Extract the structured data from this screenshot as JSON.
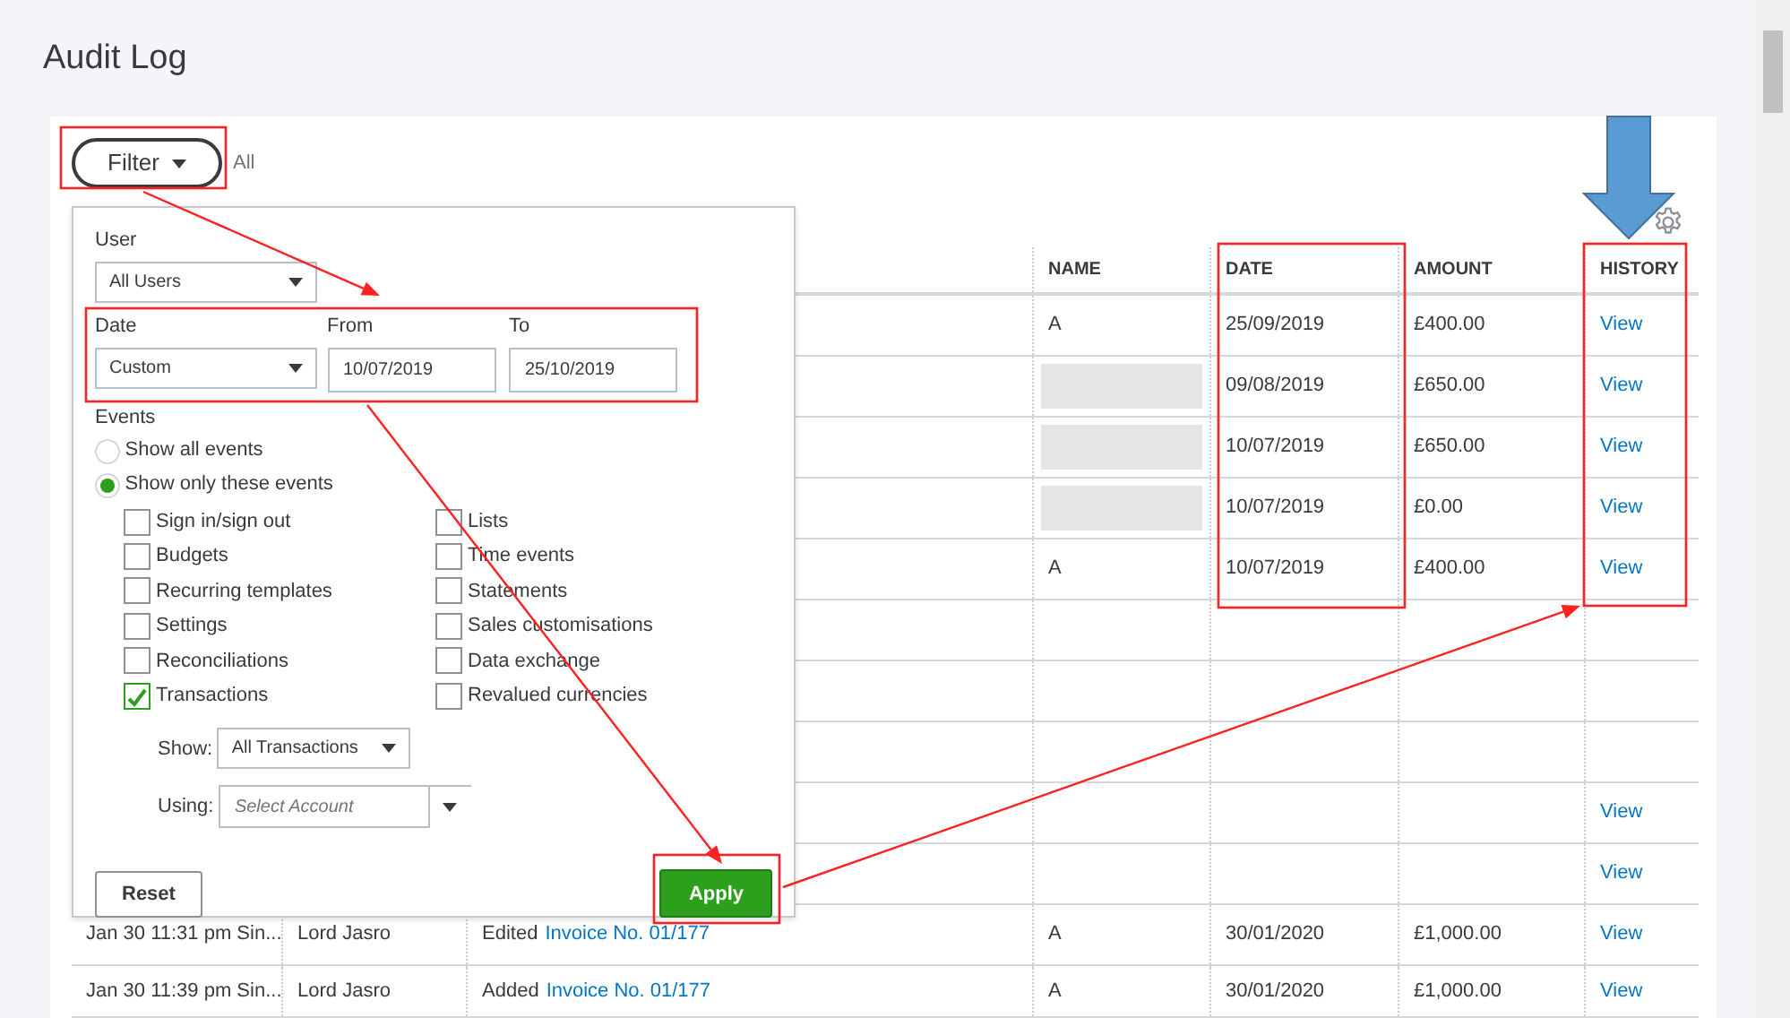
{
  "page": {
    "title": "Audit Log"
  },
  "filter": {
    "button": "Filter",
    "summary": "All",
    "open": true
  },
  "filter_panel": {
    "user": {
      "label": "User",
      "value": "All Users"
    },
    "date": {
      "label": "Date",
      "value": "Custom"
    },
    "from": {
      "label": "From",
      "value": "10/07/2019"
    },
    "to": {
      "label": "To",
      "value": "25/10/2019"
    },
    "events_label": "Events",
    "event_modes": [
      {
        "label": "Show all events",
        "selected": false
      },
      {
        "label": "Show only these events",
        "selected": true
      }
    ],
    "event_types": [
      {
        "label": "Sign in/sign out",
        "checked": false
      },
      {
        "label": "Lists",
        "checked": false
      },
      {
        "label": "Budgets",
        "checked": false
      },
      {
        "label": "Time events",
        "checked": false
      },
      {
        "label": "Recurring templates",
        "checked": false
      },
      {
        "label": "Statements",
        "checked": false
      },
      {
        "label": "Settings",
        "checked": false
      },
      {
        "label": "Sales customisations",
        "checked": false
      },
      {
        "label": "Reconciliations",
        "checked": false
      },
      {
        "label": "Data exchange",
        "checked": false
      },
      {
        "label": "Transactions",
        "checked": true
      },
      {
        "label": "Revalued currencies",
        "checked": false
      }
    ],
    "show": {
      "label": "Show:",
      "value": "All Transactions"
    },
    "using": {
      "label": "Using:",
      "placeholder": "Select Account"
    },
    "reset": "Reset",
    "apply": "Apply"
  },
  "table": {
    "columns": [
      "NAME",
      "DATE",
      "AMOUNT",
      "HISTORY"
    ],
    "rows": [
      {
        "name": "A",
        "date": "25/09/2019",
        "amount": "£400.00",
        "history": "View",
        "redacted": false
      },
      {
        "date": "09/08/2019",
        "amount": "£650.00",
        "history": "View",
        "redacted": true
      },
      {
        "date": "10/07/2019",
        "amount": "£650.00",
        "history": "View",
        "redacted": true
      },
      {
        "date": "10/07/2019",
        "amount": "£0.00",
        "history": "View",
        "redacted": true
      },
      {
        "name": "A",
        "date": "10/07/2019",
        "amount": "£400.00",
        "history": "View",
        "redacted": false
      },
      {
        "redacted": false
      },
      {
        "redacted": false
      },
      {
        "redacted": false
      },
      {
        "history": "View",
        "redacted": false
      },
      {
        "history": "View",
        "redacted": false
      },
      {
        "column_1": "Jan 30 11:31 pm Sin...",
        "column_2": "Lord Jasro",
        "action": "Edited",
        "link": "Invoice No. 01/177",
        "name": "A",
        "date": "30/01/2020",
        "amount": "£1,000.00",
        "history": "View",
        "redacted": false
      },
      {
        "column_1": "Jan 30 11:39 pm Sin...",
        "column_2": "Lord Jasro",
        "action": "Added",
        "link": "Invoice No. 01/177",
        "name": "A",
        "date": "30/01/2020",
        "amount": "£1,000.00",
        "history": "View",
        "redacted": false
      }
    ]
  }
}
